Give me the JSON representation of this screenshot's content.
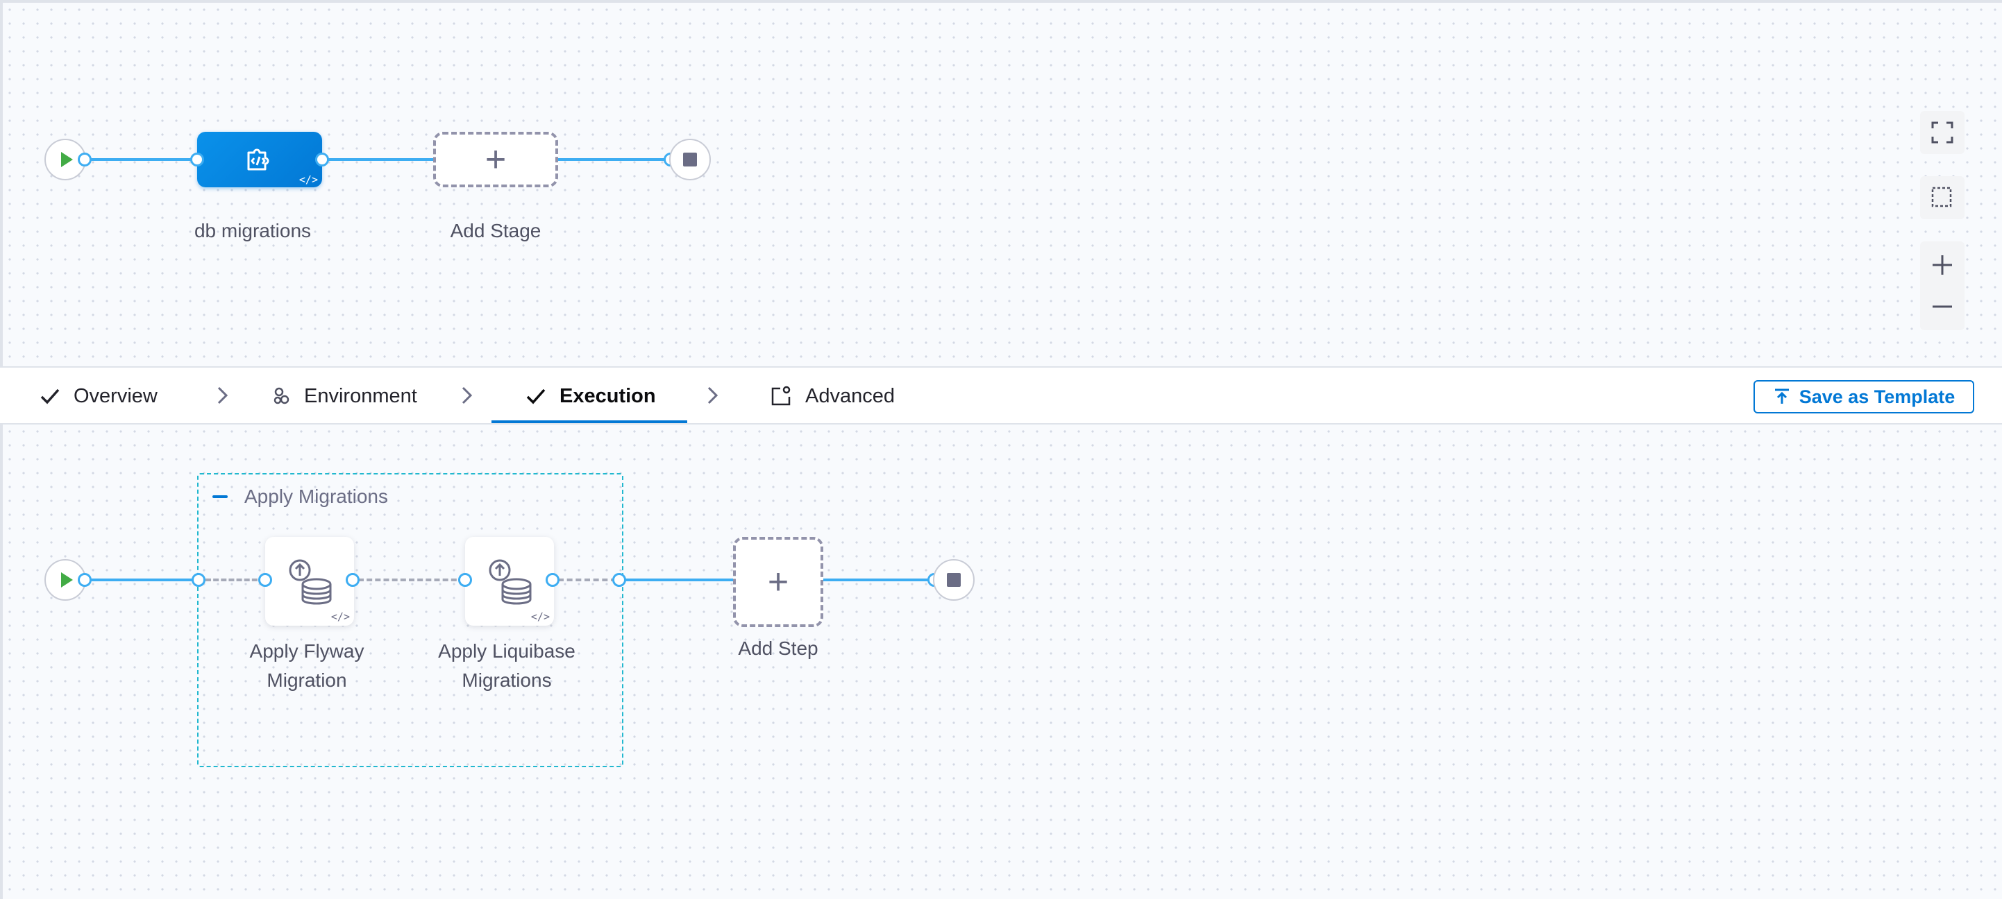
{
  "pipeline": {
    "stage": {
      "label": "db migrations",
      "icon": "custom-stage-icon"
    },
    "add_stage_label": "Add Stage"
  },
  "canvas_tools": [
    "fullscreen-icon",
    "select-area-icon",
    "zoom-in-icon",
    "zoom-out-icon"
  ],
  "tabs": [
    {
      "label": "Overview",
      "icon": "check-icon",
      "active": false
    },
    {
      "label": "Environment",
      "icon": "environment-icon",
      "active": false
    },
    {
      "label": "Execution",
      "icon": "check-icon",
      "active": true
    },
    {
      "label": "Advanced",
      "icon": "advanced-settings-icon",
      "active": false
    }
  ],
  "toolbar": {
    "save_template_label": "Save as Template"
  },
  "execution": {
    "group_title": "Apply Migrations",
    "steps": [
      {
        "label_line1": "Apply Flyway",
        "label_line2": "Migration",
        "icon": "database-migration-icon"
      },
      {
        "label_line1": "Apply Liquibase",
        "label_line2": "Migrations",
        "icon": "database-migration-icon"
      }
    ],
    "add_step_label": "Add Step"
  },
  "colors": {
    "accent": "#0278d5",
    "wire": "#3dadf2",
    "start": "#42ab45",
    "group_border": "#22b8cf"
  }
}
